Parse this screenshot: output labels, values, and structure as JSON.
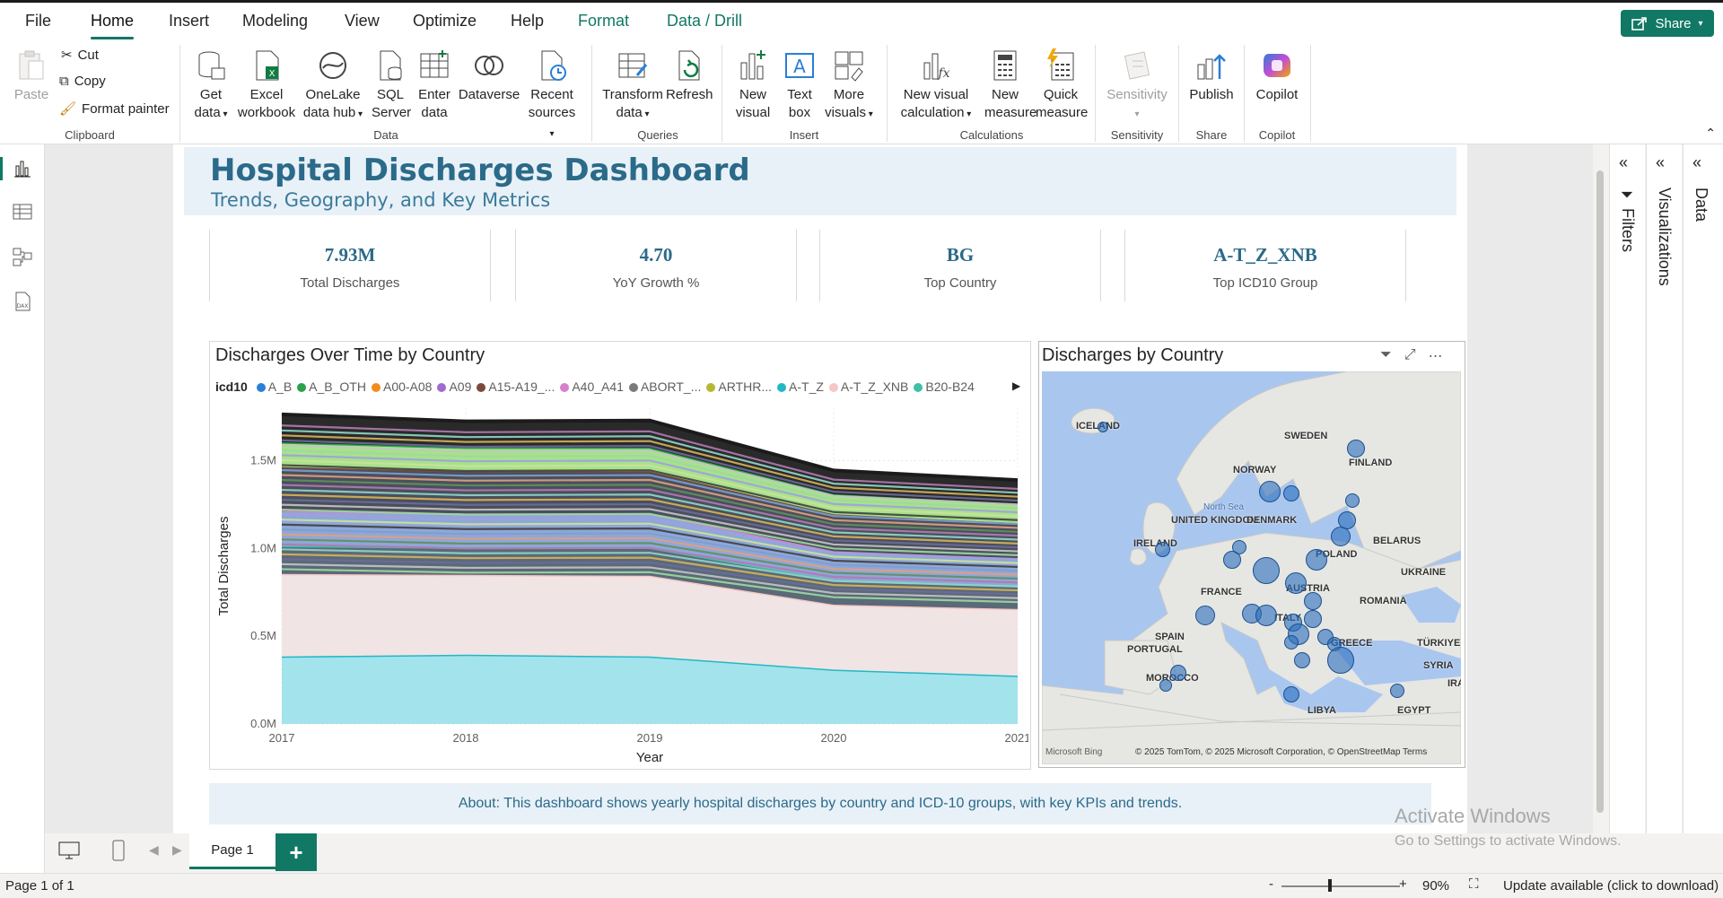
{
  "menu": {
    "tabs": [
      "File",
      "Home",
      "Insert",
      "Modeling",
      "View",
      "Optimize",
      "Help",
      "Format",
      "Data / Drill"
    ],
    "active": "Home",
    "share_label": "Share"
  },
  "ribbon": {
    "clipboard": {
      "paste": "Paste",
      "cut": "Cut",
      "copy": "Copy",
      "format_painter": "Format painter",
      "group": "Clipboard"
    },
    "data": {
      "get_data": [
        "Get",
        "data"
      ],
      "excel": [
        "Excel",
        "workbook"
      ],
      "onelake": [
        "OneLake",
        "data hub"
      ],
      "sql": [
        "SQL",
        "Server"
      ],
      "enter": [
        "Enter",
        "data"
      ],
      "dataverse": "Dataverse",
      "recent": [
        "Recent",
        "sources"
      ],
      "group": "Data"
    },
    "queries": {
      "transform": [
        "Transform",
        "data"
      ],
      "refresh": "Refresh",
      "group": "Queries"
    },
    "insert": {
      "new_visual": [
        "New",
        "visual"
      ],
      "text_box": [
        "Text",
        "box"
      ],
      "more_visuals": [
        "More",
        "visuals"
      ],
      "group": "Insert"
    },
    "calculations": {
      "new_visual_calc": [
        "New visual",
        "calculation"
      ],
      "new_measure": [
        "New",
        "measure"
      ],
      "quick_measure": [
        "Quick",
        "measure"
      ],
      "group": "Calculations"
    },
    "sensitivity": {
      "label": "Sensitivity",
      "group": "Sensitivity"
    },
    "share": {
      "publish": "Publish",
      "group": "Share"
    },
    "copilot": {
      "label": "Copilot",
      "group": "Copilot"
    }
  },
  "dashboard": {
    "title": "Hospital Discharges Dashboard",
    "subtitle": "Trends, Geography, and Key Metrics",
    "kpis": [
      {
        "value": "7.93M",
        "label": "Total Discharges"
      },
      {
        "value": "4.70",
        "label": "YoY Growth %"
      },
      {
        "value": "BG",
        "label": "Top Country"
      },
      {
        "value": "A-T_Z_XNB",
        "label": "Top ICD10 Group"
      }
    ],
    "about": "About: This dashboard shows yearly hospital discharges by country and ICD-10 groups, with key KPIs and trends."
  },
  "chart_data": {
    "type": "area",
    "title": "Discharges Over Time by Country",
    "xlabel": "Year",
    "ylabel": "Total Discharges",
    "legend_title": "icd10",
    "legend_position": "top",
    "x": [
      2017,
      2018,
      2019,
      2020,
      2021
    ],
    "ytick_labels": [
      "0.0M",
      "0.5M",
      "1.0M",
      "1.5M"
    ],
    "ylim": [
      0,
      1800000
    ],
    "grid": true,
    "stacked": true,
    "series": [
      {
        "name": "A-T_Z",
        "color": "#21b8c6",
        "values": [
          385000,
          395000,
          385000,
          310000,
          275000
        ],
        "fill": "#a3e3ec"
      },
      {
        "name": "A-T_Z_XNB",
        "color": "#f4c6c6",
        "values": [
          470000,
          455000,
          460000,
          370000,
          380000
        ],
        "fill": "#f1e4e4"
      },
      {
        "name": "B20-B24",
        "color": "#3fbfa6",
        "values": [
          160000,
          155000,
          160000,
          140000,
          130000
        ],
        "fill": "#5a6a78"
      },
      {
        "name": "A40_A41",
        "color": "#d580c9",
        "values": [
          200000,
          195000,
          195000,
          165000,
          160000
        ],
        "fill": "#8fa7d8"
      },
      {
        "name": "A15-A19_...",
        "color": "#7a4a3a",
        "values": [
          250000,
          240000,
          240000,
          210000,
          200000
        ],
        "fill": "#4a4f5c"
      },
      {
        "name": "A_B_OTH",
        "color": "#2aa14b",
        "values": [
          140000,
          135000,
          135000,
          115000,
          110000
        ],
        "fill": "#a7e28a"
      },
      {
        "name": "A_B",
        "color": "#2a7fd6",
        "values": [
          160000,
          150000,
          155000,
          135000,
          135000
        ],
        "fill": "#2a2a2a"
      }
    ],
    "legend_entries": [
      "A_B",
      "A_B_OTH",
      "A00-A08",
      "A09",
      "A15-A19_...",
      "A40_A41",
      "ABORT_...",
      "ARTHR...",
      "A-T_Z",
      "A-T_Z_XNB",
      "B20-B24"
    ],
    "legend_colors": [
      "#2a7fd6",
      "#2aa14b",
      "#f28a1e",
      "#a06ad0",
      "#7a4a3a",
      "#d580c9",
      "#7a7a7a",
      "#b7b832",
      "#21b8c6",
      "#f4c6c6",
      "#3fbfa6"
    ]
  },
  "map": {
    "title": "Discharges by Country",
    "labels": [
      "ICELAND",
      "SWEDEN",
      "FINLAND",
      "NORWAY",
      "North Sea",
      "UNITED KINGDOM",
      "DENMARK",
      "IRELAND",
      "BELARUS",
      "POLAND",
      "UKRAINE",
      "FRANCE",
      "AUSTRIA",
      "ROMANIA",
      "ITALY",
      "SPAIN",
      "PORTUGAL",
      "GREECE",
      "TÜRKIYE",
      "SYRIA",
      "MOROCCO",
      "LIBYA",
      "EGYPT",
      "IRA"
    ],
    "attribution": "© 2025 TomTom, © 2025 Microsoft Corporation, © OpenStreetMap Terms",
    "bing": "Microsoft Bing"
  },
  "pages": {
    "tab": "Page 1"
  },
  "status": {
    "page": "Page 1 of 1",
    "zoom": "90%",
    "update": "Update available (click to download)"
  },
  "panes": {
    "filters": "Filters",
    "visualizations": "Visualizations",
    "data": "Data"
  },
  "watermark": {
    "line1": "Activate Windows",
    "line2": "Go to Settings to activate Windows."
  }
}
